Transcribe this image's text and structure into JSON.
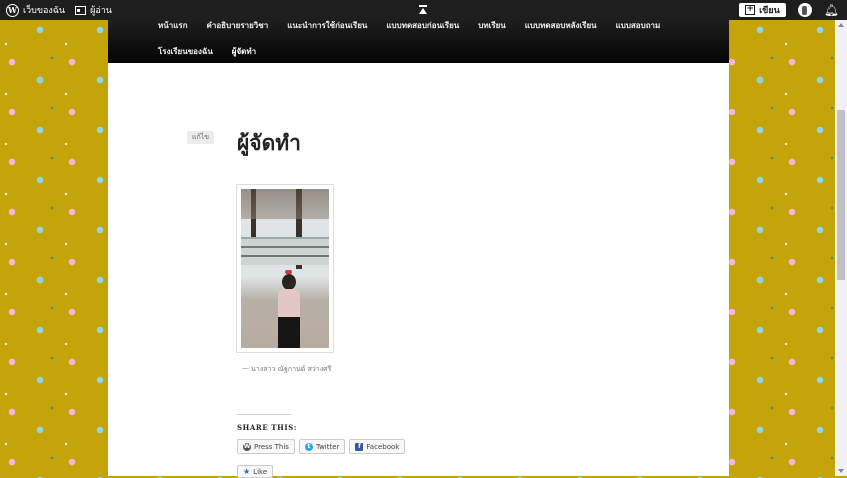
{
  "adminbar": {
    "my_site_label": "เว็บของฉัน",
    "reader_label": "ผู้อ่าน",
    "write_label": "เขียน"
  },
  "nav": {
    "row1": [
      "หน้าแรก",
      "คำอธิบายรายวิชา",
      "แนะนำการใช้ก่อนเรียน",
      "แบบทดสอบก่อนเรียน",
      "บทเรียน",
      "แบบทดสอบหลังเรียน",
      "แบบสอบถาม"
    ],
    "row2": [
      "โรงเรียนของฉัน",
      "ผู้จัดทำ"
    ]
  },
  "post": {
    "edit_label": "แก้ไข",
    "title": "ผู้จัดทำ",
    "caption_dash": "—",
    "caption": "นางสาว ณัฐกานต์ สว่างศรี"
  },
  "share": {
    "title": "SHARE THIS:",
    "buttons": [
      "Press This",
      "Twitter",
      "Facebook"
    ],
    "like_label": "Like"
  },
  "colors": {
    "background": "#c4a409",
    "navbar": "#0b0b0b",
    "adminbar": "#1e1e1e"
  }
}
